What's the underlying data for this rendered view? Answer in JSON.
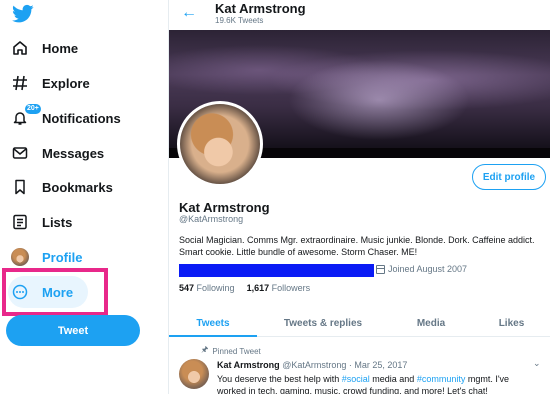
{
  "colors": {
    "accent": "#1da1f2",
    "highlight": "#e8288a",
    "bar": "#0a1bf5"
  },
  "sidebar": {
    "logo_icon": "twitter-bird-icon",
    "items": [
      {
        "label": "Home",
        "icon": "home-icon"
      },
      {
        "label": "Explore",
        "icon": "hashtag-icon"
      },
      {
        "label": "Notifications",
        "icon": "bell-icon",
        "badge": "20+"
      },
      {
        "label": "Messages",
        "icon": "envelope-icon"
      },
      {
        "label": "Bookmarks",
        "icon": "bookmark-icon"
      },
      {
        "label": "Lists",
        "icon": "list-icon"
      },
      {
        "label": "Profile",
        "icon": "avatar-icon"
      },
      {
        "label": "More",
        "icon": "more-circle-icon"
      }
    ],
    "tweet_button": "Tweet"
  },
  "header": {
    "title": "Kat Armstrong",
    "subtitle": "19.6K Tweets"
  },
  "profile": {
    "edit_button": "Edit profile",
    "name": "Kat Armstrong",
    "handle": "@KatArmstrong",
    "bio": "Social Magician. Comms Mgr.  extraordinaire. Music junkie. Blonde. Dork. Caffeine addict. Smart cookie. Little bundle of awesome. Storm Chaser. ME!",
    "joined": "Joined August 2007",
    "following_count": "547",
    "following_label": "Following",
    "followers_count": "1,617",
    "followers_label": "Followers"
  },
  "tabs": [
    "Tweets",
    "Tweets & replies",
    "Media",
    "Likes"
  ],
  "pinned_tweet": {
    "pinned_label": "Pinned Tweet",
    "author": "Kat Armstrong",
    "handle": "@KatArmstrong",
    "separator": "·",
    "date": "Mar 25, 2017",
    "text_1": "You deserve the best help with ",
    "tag_1": "#social",
    "text_2": " media and ",
    "tag_2": "#community",
    "text_3": " mgmt. I've worked in tech, gaming, music, crowd funding, and more! Let's chat!"
  }
}
